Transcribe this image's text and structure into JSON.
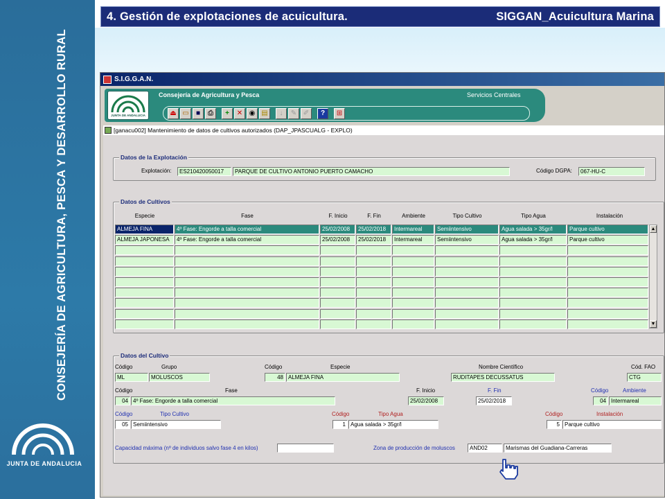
{
  "slide": {
    "title": "4. Gestión de explotaciones de acuicultura.",
    "subtitle": "SIGGAN_Acuicultura Marina",
    "vertical_text": "CONSEJERÍA DE AGRICULTURA, PESCA Y DESARROLLO RURAL",
    "logo_text": "JUNTA DE ANDALUCIA",
    "colors": {
      "band": "#2b6f9d",
      "title_bar": "#1b2c78"
    }
  },
  "app": {
    "window_title": "S.I.G.G.A.N.",
    "header_title": "Consejería de Agricultura y Pesca",
    "header_service": "Servicios Centrales",
    "logo_text": "JUNTA DE ANDALUCIA",
    "toolbar_icons": [
      "exit-icon",
      "open-folder-icon",
      "save-icon",
      "print-icon",
      "add-icon",
      "delete-icon",
      "search-icon",
      "document-icon",
      "arrow-down-icon",
      "edit-icon",
      "edit2-icon",
      "help-icon",
      "network-icon"
    ],
    "form_title": "[ganacu002] Mantenimiento de datos de cultivos autorizados   (DAP_JPASCUALG - EXPLO)"
  },
  "explotacion": {
    "legend": "Datos de la Explotación",
    "label": "Explotación:",
    "code": "ES210420050017",
    "name": "PARQUE DE CULTIVO ANTONIO PUERTO CAMACHO",
    "dgpa_label": "Código DGPA:",
    "dgpa": "067-HU-C"
  },
  "cultivos": {
    "legend": "Datos de Cultivos",
    "headers": [
      "Especie",
      "Fase",
      "F. Inicio",
      "F. Fin",
      "Ambiente",
      "Tipo Cultivo",
      "Tipo Agua",
      "Instalación"
    ],
    "rows": [
      [
        "ALMEJA FINA",
        "4º Fase: Engorde a talla comercial",
        "25/02/2008",
        "25/02/2018",
        "Intermareal",
        "Semiintensivo",
        "Agua salada > 35gr/l",
        "Parque cultivo"
      ],
      [
        "ALMEJA JAPONESA",
        "4º Fase: Engorde a talla comercial",
        "25/02/2008",
        "25/02/2018",
        "Intermareal",
        "Semiintensivo",
        "Agua salada > 35gr/l",
        "Parque cultivo"
      ]
    ]
  },
  "cultivo": {
    "legend": "Datos del Cultivo",
    "lbl_codigo": "Código",
    "lbl_grupo": "Grupo",
    "lbl_especie": "Especie",
    "lbl_nombre": "Nombre Científico",
    "lbl_fao": "Cód. FAO",
    "grupo_code": "ML",
    "grupo": "MOLUSCOS",
    "especie_code": "48",
    "especie": "ALMEJA FINA",
    "nombre": "RUDITAPES DECUSSATUS",
    "fao": "CTG",
    "lbl_fase": "Fase",
    "lbl_finicio": "F. Inicio",
    "lbl_ffin": "F. Fin",
    "lbl_ambiente": "Ambiente",
    "fase_code": "04",
    "fase": "4º Fase: Engorde a talla comercial",
    "finicio": "25/02/2008",
    "ffin": "25/02/2018",
    "ambiente_code": "04",
    "ambiente": "Intermareal",
    "lbl_tipo_cultivo": "Tipo Cultivo",
    "lbl_tipo_agua": "Tipo Agua",
    "lbl_instalacion": "Instalación",
    "tipo_cultivo_code": "05",
    "tipo_cultivo": "Semiintensivo",
    "tipo_agua_code": "1",
    "tipo_agua": "Agua salada > 35gr/l",
    "instalacion_code": "5",
    "instalacion": "Parque cultivo",
    "lbl_capacidad": "Capacidad máxima (nº de individuos salvo fase 4 en kilos)",
    "capacidad": "",
    "lbl_zona": "Zona de producción de moluscos",
    "zona_code": "AND02",
    "zona": "Marismas del Guadiana-Carreras"
  }
}
